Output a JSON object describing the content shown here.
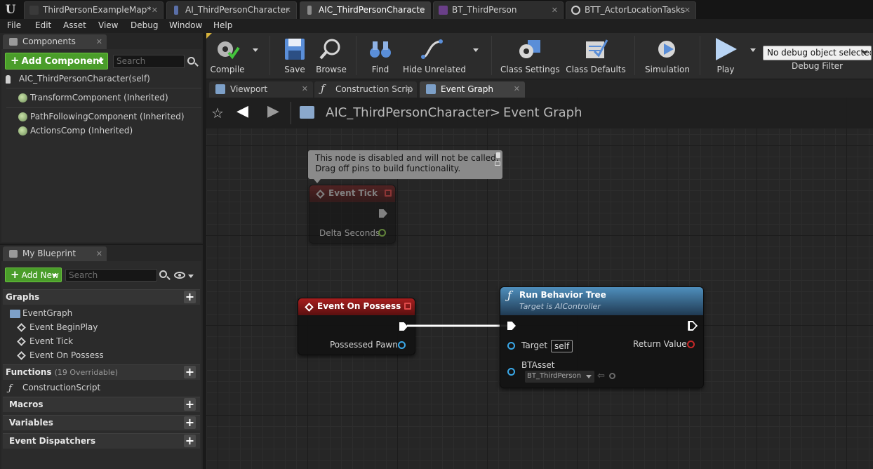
{
  "app": {
    "logo_text": "U",
    "doc_tabs": [
      {
        "label": "ThirdPersonExampleMap*"
      },
      {
        "label": "AI_ThirdPersonCharacter"
      },
      {
        "label": "AIC_ThirdPersonCharacte"
      },
      {
        "label": "BT_ThirdPerson"
      },
      {
        "label": "BTT_ActorLocationTasks"
      }
    ],
    "menu": [
      "File",
      "Edit",
      "Asset",
      "View",
      "Debug",
      "Window",
      "Help"
    ]
  },
  "components_panel": {
    "title": "Components",
    "add_label": "Add Component",
    "search_placeholder": "Search",
    "self_item": "AIC_ThirdPersonCharacter(self)",
    "items": [
      "TransformComponent (Inherited)",
      "PathFollowingComponent (Inherited)",
      "ActionsComp (Inherited)"
    ]
  },
  "my_blueprint": {
    "title": "My Blueprint",
    "add_label": "Add New",
    "search_placeholder": "Search",
    "graphs_label": "Graphs",
    "event_graph_label": "EventGraph",
    "events": [
      "Event BeginPlay",
      "Event Tick",
      "Event On Possess"
    ],
    "functions_label": "Functions",
    "functions_sub": "(19 Overridable)",
    "construction_label": "ConstructionScript",
    "macros_label": "Macros",
    "variables_label": "Variables",
    "dispatchers_label": "Event Dispatchers"
  },
  "toolbar": {
    "compile": "Compile",
    "save": "Save",
    "browse": "Browse",
    "find": "Find",
    "hide_unrelated": "Hide Unrelated",
    "class_settings": "Class Settings",
    "class_defaults": "Class Defaults",
    "simulation": "Simulation",
    "play": "Play",
    "debug_selected": "No debug object selected",
    "debug_filter": "Debug Filter"
  },
  "editor_tabs": [
    "Viewport",
    "Construction Scrip",
    "Event Graph"
  ],
  "breadcrumb": {
    "blueprint": "AIC_ThirdPersonCharacter",
    "separator": ">",
    "graph": "Event Graph"
  },
  "graph": {
    "tooltip_line1": "This node is disabled and will not be called.",
    "tooltip_line2": "Drag off pins to build functionality.",
    "event_tick": {
      "title": "Event Tick",
      "pin": "Delta Seconds"
    },
    "on_possess": {
      "title": "Event On Possess",
      "pin": "Possessed Pawn"
    },
    "run_bt": {
      "title": "Run Behavior Tree",
      "subtitle": "Target is AIController",
      "target_label": "Target",
      "target_value": "self",
      "return_label": "Return Value",
      "asset_label": "BTAsset",
      "asset_value": "BT_ThirdPerson"
    }
  },
  "colors": {
    "event_header": "#8b1a1a",
    "function_header": "#2b5f86",
    "exec_wire": "#ffffff",
    "object_pin": "#3aa8e8",
    "bool_pin": "#c62828",
    "float_pin": "#8bc34a"
  }
}
